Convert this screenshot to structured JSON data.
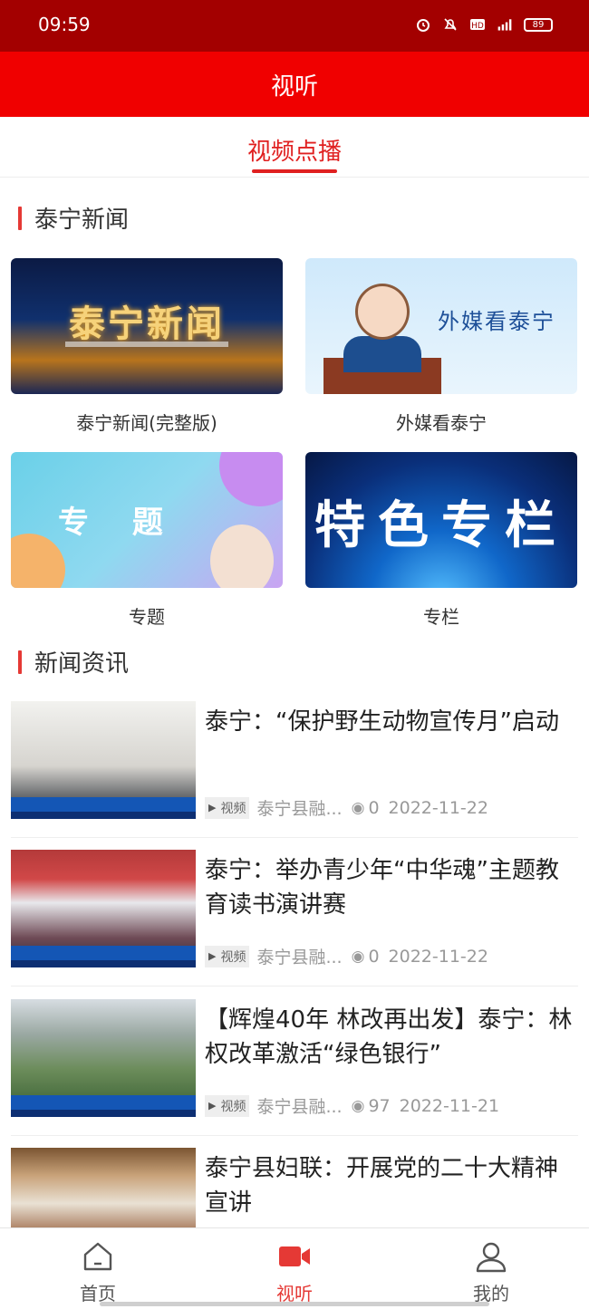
{
  "status": {
    "time": "09:59",
    "battery": "89"
  },
  "header": {
    "title": "视听"
  },
  "tabs": {
    "active": "视频点播"
  },
  "sections": {
    "tv": {
      "title": "泰宁新闻"
    },
    "news": {
      "title": "新闻资讯"
    }
  },
  "cards": [
    {
      "label": "泰宁新闻(完整版)",
      "thumb_text": "泰宁新闻"
    },
    {
      "label": "外媒看泰宁",
      "thumb_text": "外媒看泰宁"
    },
    {
      "label": "专题",
      "thumb_text": "专 题"
    },
    {
      "label": "专栏",
      "thumb_text": "特色专栏"
    }
  ],
  "news": [
    {
      "title": "泰宁：“保护野生动物宣传月”启动",
      "tag": "视频",
      "source": "泰宁县融...",
      "views": "0",
      "date": "2022-11-22"
    },
    {
      "title": "泰宁：举办青少年“中华魂”主题教育读书演讲赛",
      "tag": "视频",
      "source": "泰宁县融...",
      "views": "0",
      "date": "2022-11-22"
    },
    {
      "title": "【辉煌40年 林改再出发】泰宁：林权改革激活“绿色银行”",
      "tag": "视频",
      "source": "泰宁县融...",
      "views": "97",
      "date": "2022-11-21"
    },
    {
      "title": "泰宁县妇联：开展党的二十大精神宣讲"
    }
  ],
  "bottom_nav": [
    {
      "label": "首页",
      "icon": "home-icon"
    },
    {
      "label": "视听",
      "icon": "video-camera-icon"
    },
    {
      "label": "我的",
      "icon": "user-icon"
    }
  ],
  "colors": {
    "accent": "#e53935",
    "header": "#f00000",
    "statusbar": "#a30000"
  }
}
